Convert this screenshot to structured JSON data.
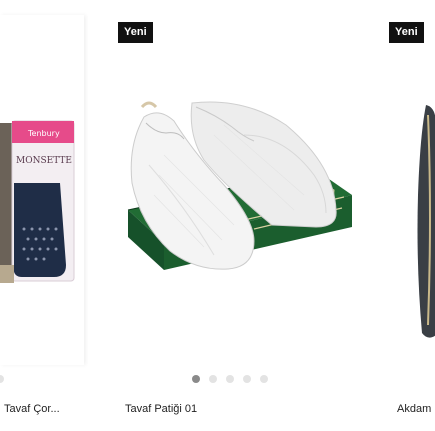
{
  "products": [
    {
      "title": "Tavaf Çor...",
      "image_alt": "Monsette socks package",
      "badge": ""
    },
    {
      "title": "Tavaf Patiği 01",
      "image_alt": "White mesh tavaf slippers with green box",
      "badge": "Yeni"
    },
    {
      "title": "Akdam",
      "image_alt": "Product partially visible",
      "badge": "Yeni"
    }
  ],
  "socks_brand": "MONSETTE",
  "socks_tag": "Tenbury",
  "carousel": {
    "total": 5,
    "active_index": 0
  },
  "colors": {
    "badge_bg": "#111111",
    "badge_text": "#ffffff",
    "box_green": "#1f6b33",
    "dot_active": "#8a8a8a",
    "dot_inactive": "#e3e3e3"
  }
}
